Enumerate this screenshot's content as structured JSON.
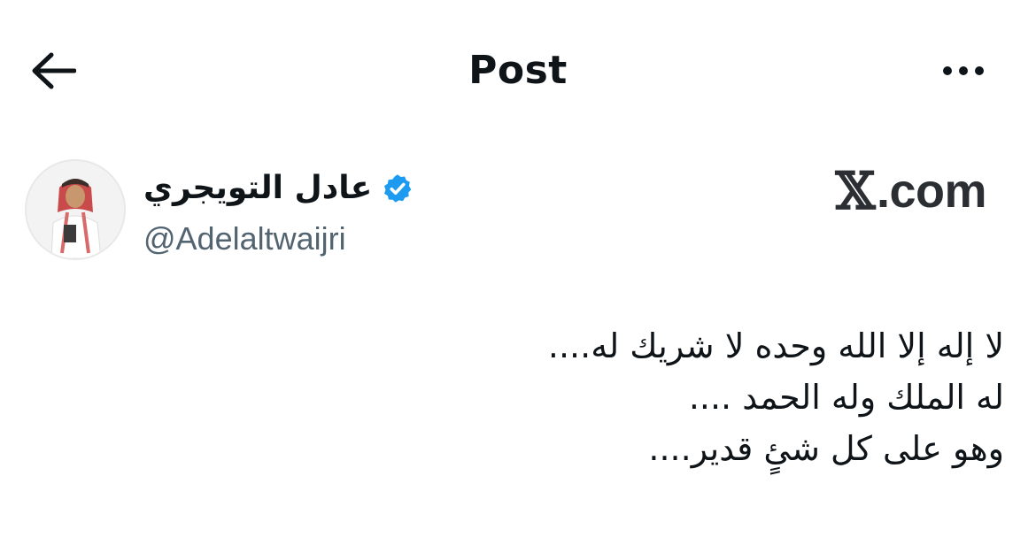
{
  "header": {
    "title": "Post",
    "back_icon": "back-arrow-icon",
    "more_icon": "more-horizontal-icon"
  },
  "author": {
    "display_name": "عادل التويجري",
    "handle": "@Adelaltwaijri",
    "verified": true,
    "verified_color": "#1d9bf0"
  },
  "brand": {
    "x_glyph": "𝕏",
    "suffix": ".com"
  },
  "post": {
    "lines": [
      "لا إله إلا الله وحده لا شريك له....",
      "له الملك وله الحمد ....",
      "وهو على كل شئٍ قدير...."
    ]
  }
}
